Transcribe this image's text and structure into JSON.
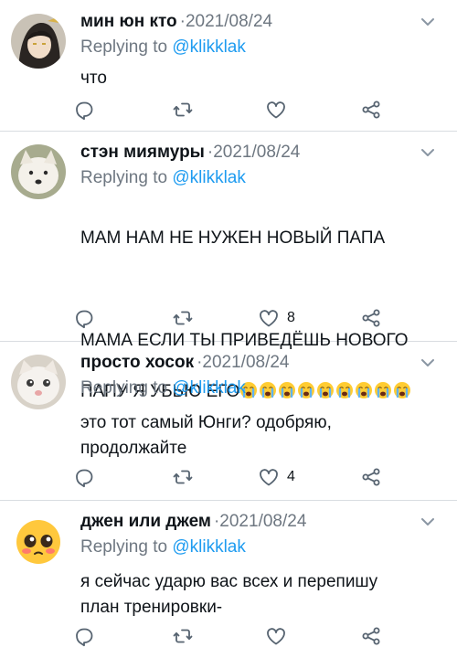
{
  "colors": {
    "text": "#0f1419",
    "muted": "#6e7781",
    "link": "#1d9bf0",
    "divider": "#d9dde1"
  },
  "icons": {
    "reply": "speech-bubble-icon",
    "retweet": "retweet-icon",
    "like": "heart-icon",
    "share": "share-icon",
    "more": "chevron-down-icon"
  },
  "tweets": [
    {
      "name": "мин юн кто",
      "dot": "·",
      "date": "2021/08/24",
      "replying_prefix": "Replying to",
      "mention": "@klikklak",
      "text": "что",
      "likes": ""
    },
    {
      "name": "стэн миямуры",
      "dot": "·",
      "date": "2021/08/24",
      "replying_prefix": "Replying to",
      "mention": "@klikklak",
      "text_line1": "МАМ НАМ НЕ НУЖЕН НОВЫЙ ПАПА",
      "text_line2": "МАМА ЕСЛИ ТЫ ПРИВЕДЁШЬ НОВОГО",
      "text_line3": "ПАПУ Я УБЬЮ ЕГО",
      "emoji": "😭😭😭😭😭😭😭😭😭",
      "likes": "8"
    },
    {
      "name": "просто хосок",
      "dot": "·",
      "date": "2021/08/24",
      "replying_prefix": "Replying to",
      "mention": "@klikklak",
      "text": "это тот самый Юнги? одобряю,\nпродолжайте",
      "likes": "4"
    },
    {
      "name": "джен или джем",
      "dot": "·",
      "date": "2021/08/24",
      "replying_prefix": "Replying to",
      "mention": "@klikklak",
      "text": "я сейчас ударю вас всех и перепишу\nплан тренировки-",
      "likes": ""
    }
  ]
}
